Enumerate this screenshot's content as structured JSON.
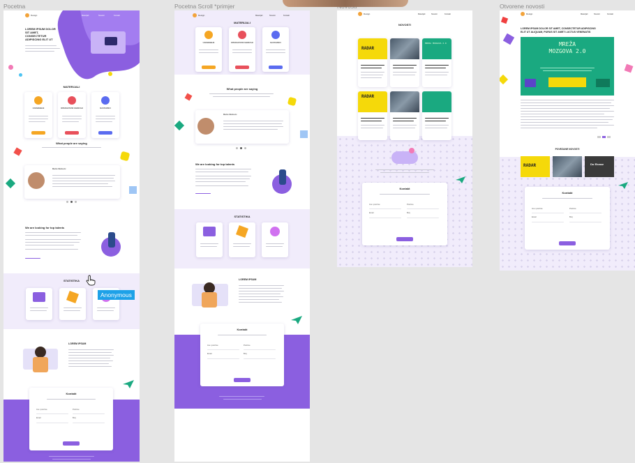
{
  "frames": [
    {
      "label": "Pocetna"
    },
    {
      "label": "Pocetna Scroll *primjer"
    },
    {
      "label": "Novosti"
    },
    {
      "label": "Otvorene novosti"
    }
  ],
  "nav": {
    "logo_text": "Design",
    "links": [
      "Materijali",
      "Novosti",
      "Kontakt"
    ]
  },
  "home": {
    "hero_title_l1": "LOREM IPSUM DOLOR",
    "hero_title_l2": "SIT AMET,",
    "hero_title_l3": "CONSECTETUR",
    "hero_title_l4": "ADIPISCING ELIT UT",
    "materials_title": "MATERIJALI",
    "materials_cards": [
      "UCENIKEBJE",
      "INTERAKTIVNI SADRZAJI",
      "NASTAVNICI"
    ],
    "testimonials_title": "What people are saying",
    "testimonial_name": "Marko Markovic",
    "talents_title": "We are looking for top talents",
    "stats_title": "STATISTIKA",
    "lorem_title": "LOREM IPSUM",
    "contact_title": "Kontakt",
    "contact_fields": [
      "Ime i prezime",
      "Prezime",
      "Email",
      "Broj"
    ],
    "send_label": "Posalji"
  },
  "news": {
    "title": "NOVOSTI",
    "radar_text": "RADAR",
    "teal_card_text": "MREZA MOZGOVA 2.0"
  },
  "open_news": {
    "headline_l1": "LOREM IPSUM DOLOR SIT AMET, CONSECTETUR ADIPISCING",
    "headline_l2": "ELIT UT ALIQUAM, PURUS SIT AMET LUCTUS VENENATIS",
    "banner_l1": "MREŽA",
    "banner_l2": "MOZGOVA 2.0",
    "recent_title": "POVEZANE NOVOSTI",
    "recent_last": "Du Eicase"
  },
  "overlay": {
    "anonymous_label": "Anonymous"
  },
  "colors": {
    "purple": "#8b5fe0",
    "lavender": "#f1ecfb",
    "yellow": "#f5d90a",
    "teal": "#1aa980",
    "cyan": "#1da1e8"
  }
}
